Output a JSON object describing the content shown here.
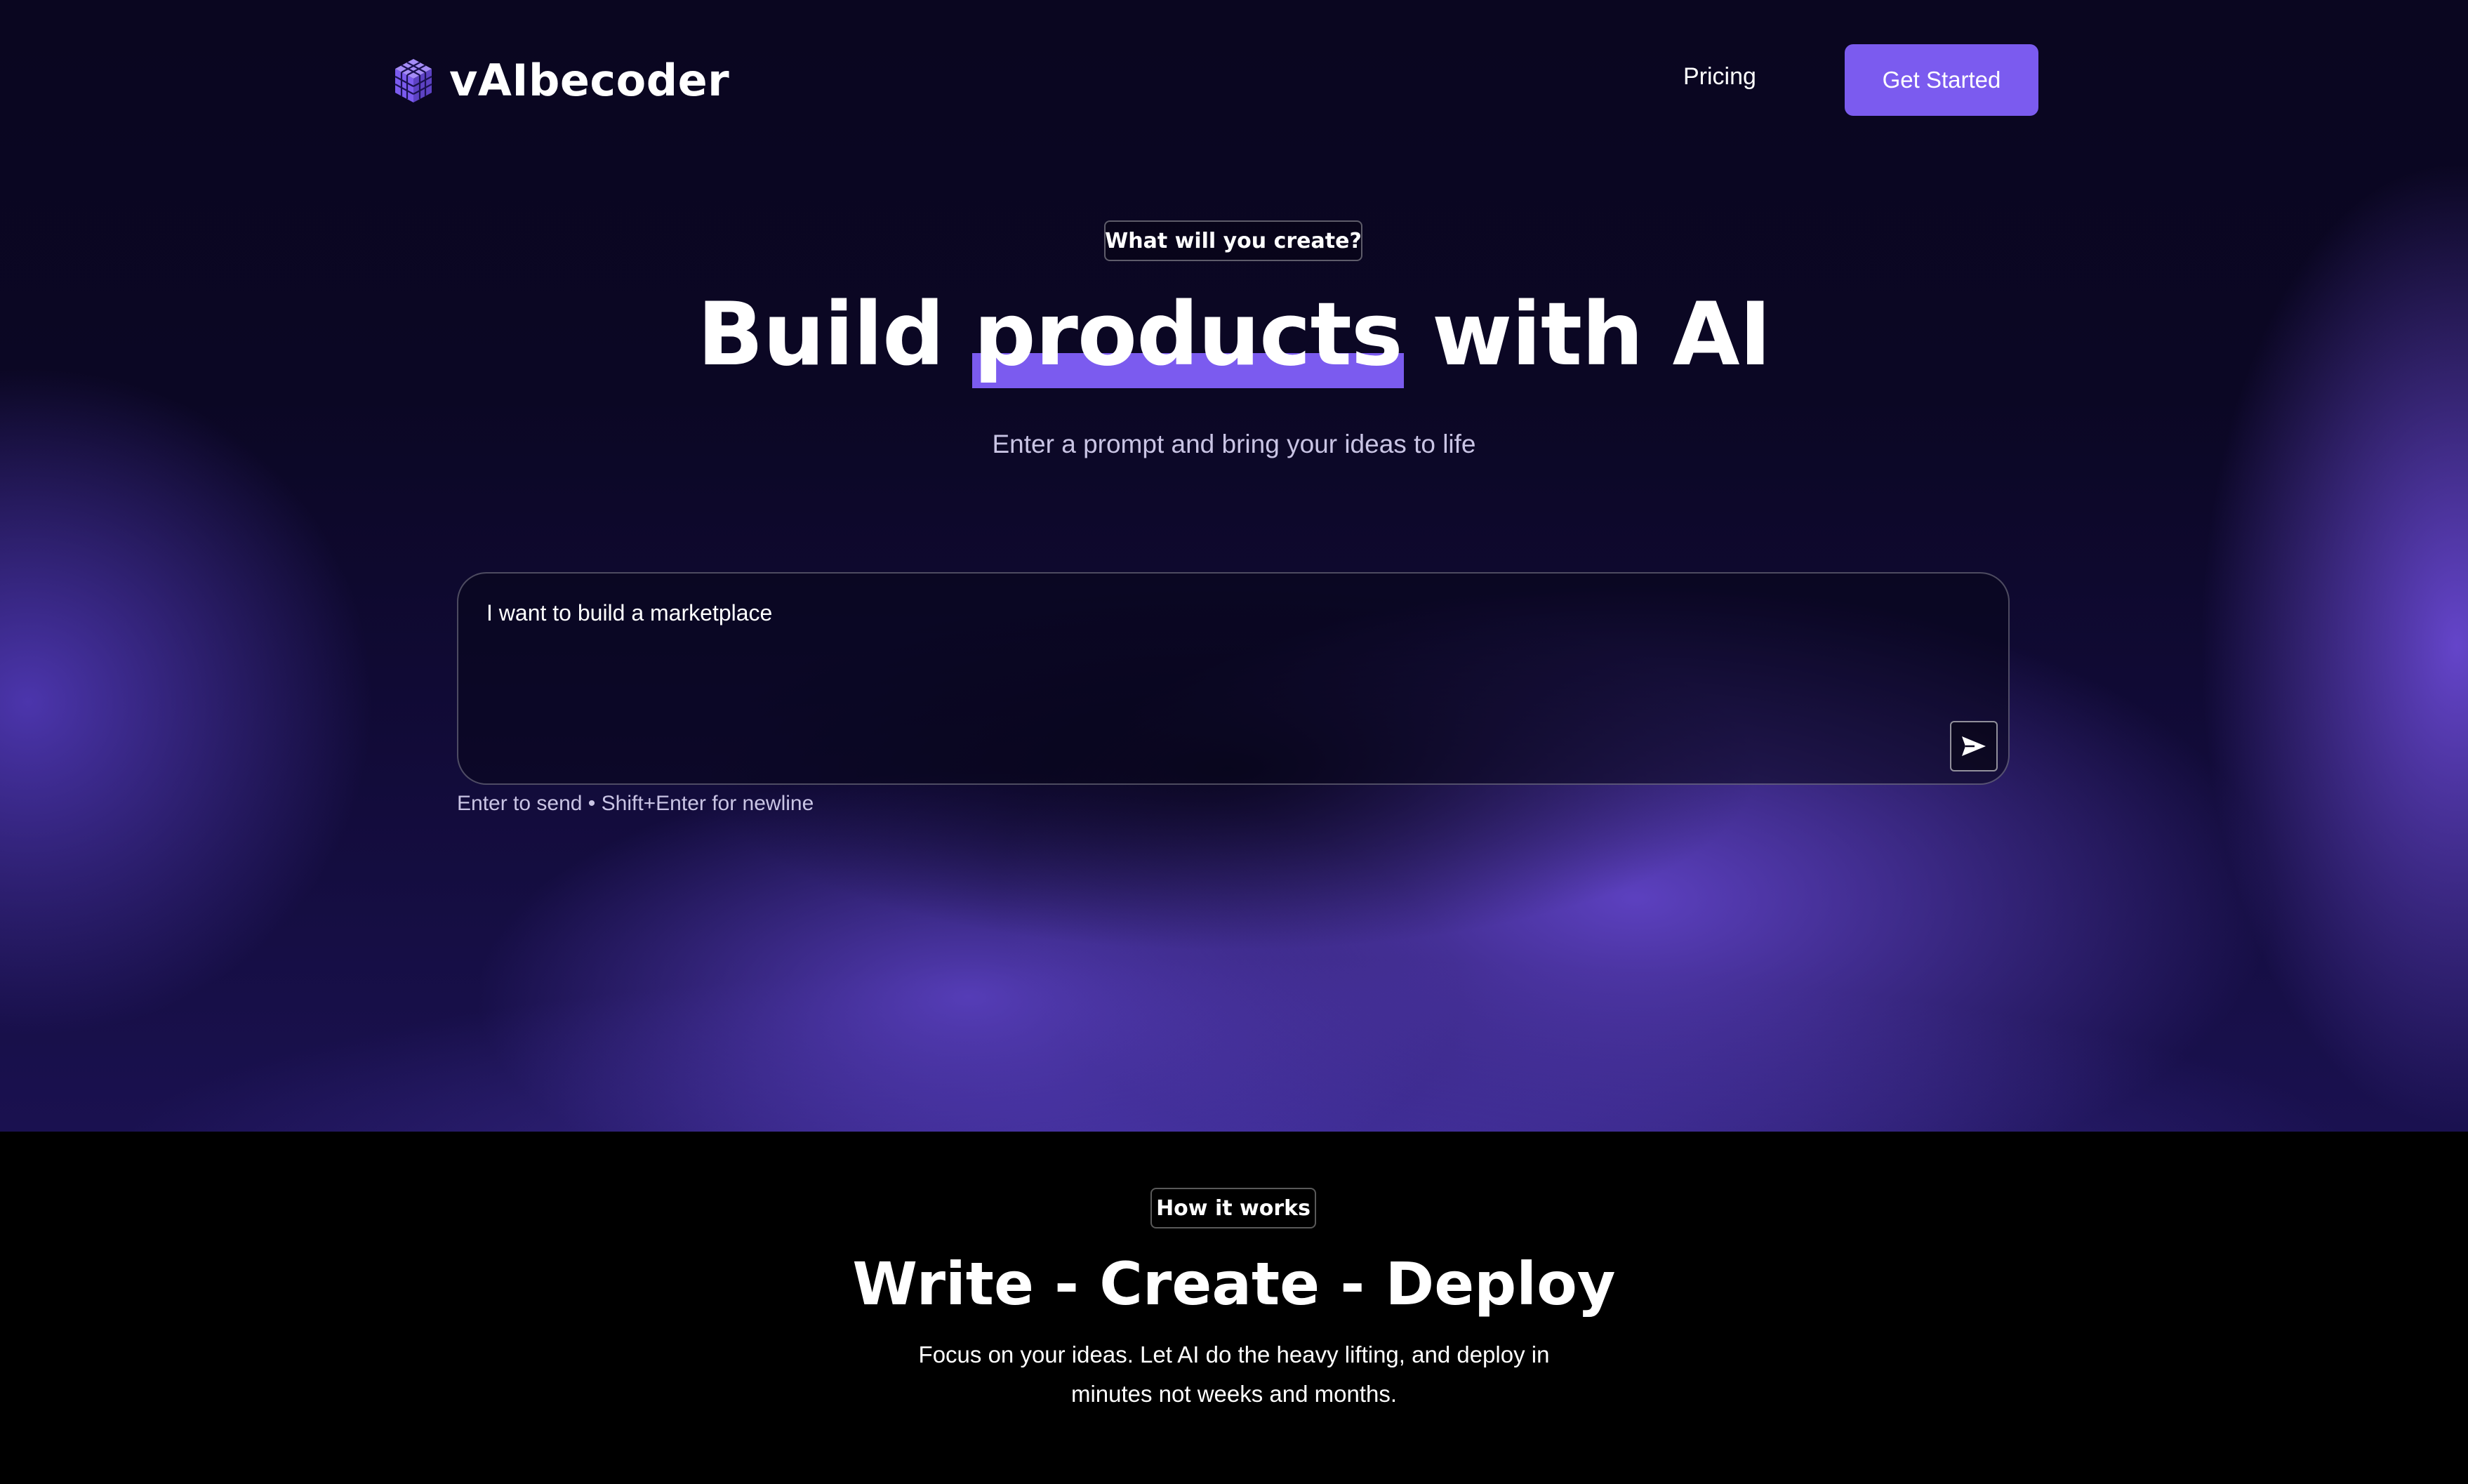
{
  "nav": {
    "brand": "vAIbecoder",
    "pricing": "Pricing",
    "cta": "Get Started"
  },
  "hero": {
    "pill": "What will you create?",
    "title_before": "Build ",
    "title_highlight": "products",
    "title_after": " with AI",
    "subtitle": "Enter a prompt and bring your ideas to life",
    "prompt_value": "I want to build a marketplace",
    "hint": "Enter to send • Shift+Enter for newline"
  },
  "how": {
    "pill": "How it works",
    "title": "Write - Create - Deploy",
    "desc": "Focus on your ideas. Let AI do the heavy lifting, and deploy in minutes not weeks and months."
  },
  "colors": {
    "accent": "#7b5bef",
    "hero_bg": "#0a0620",
    "section_bg": "#000000"
  },
  "icons": {
    "logo": "cube-logo-icon",
    "send": "send-arrow-icon"
  }
}
